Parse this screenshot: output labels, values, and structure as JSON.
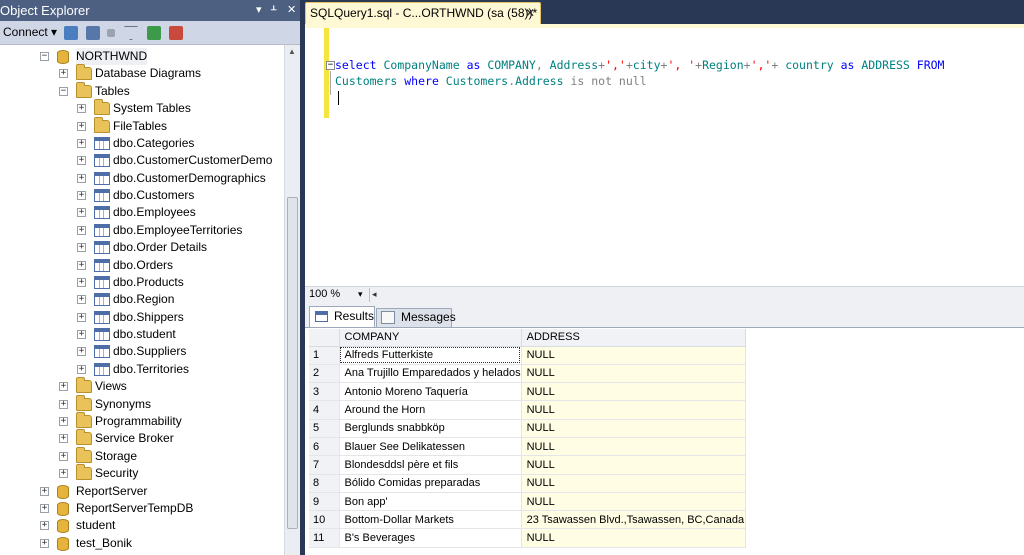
{
  "object_explorer": {
    "title": "Object Explorer",
    "pin_label": "▾ ⊥ ✕",
    "connect_label": "Connect ▾",
    "tree": [
      {
        "label": "NORTHWND",
        "icon": "database-icon",
        "expander": "−",
        "depth": 2,
        "selected": true
      },
      {
        "label": "Database Diagrams",
        "icon": "folder-icon",
        "expander": "+",
        "depth": 3
      },
      {
        "label": "Tables",
        "icon": "folder-icon",
        "expander": "−",
        "depth": 3
      },
      {
        "label": "System Tables",
        "icon": "folder-icon",
        "expander": "+",
        "depth": 4
      },
      {
        "label": "FileTables",
        "icon": "folder-icon",
        "expander": "+",
        "depth": 4
      },
      {
        "label": "dbo.Categories",
        "icon": "table-icon",
        "expander": "+",
        "depth": 4
      },
      {
        "label": "dbo.CustomerCustomerDemo",
        "icon": "table-icon",
        "expander": "+",
        "depth": 4
      },
      {
        "label": "dbo.CustomerDemographics",
        "icon": "table-icon",
        "expander": "+",
        "depth": 4
      },
      {
        "label": "dbo.Customers",
        "icon": "table-icon",
        "expander": "+",
        "depth": 4
      },
      {
        "label": "dbo.Employees",
        "icon": "table-icon",
        "expander": "+",
        "depth": 4
      },
      {
        "label": "dbo.EmployeeTerritories",
        "icon": "table-icon",
        "expander": "+",
        "depth": 4
      },
      {
        "label": "dbo.Order Details",
        "icon": "table-icon",
        "expander": "+",
        "depth": 4
      },
      {
        "label": "dbo.Orders",
        "icon": "table-icon",
        "expander": "+",
        "depth": 4
      },
      {
        "label": "dbo.Products",
        "icon": "table-icon",
        "expander": "+",
        "depth": 4
      },
      {
        "label": "dbo.Region",
        "icon": "table-icon",
        "expander": "+",
        "depth": 4
      },
      {
        "label": "dbo.Shippers",
        "icon": "table-icon",
        "expander": "+",
        "depth": 4
      },
      {
        "label": "dbo.student",
        "icon": "table-icon",
        "expander": "+",
        "depth": 4
      },
      {
        "label": "dbo.Suppliers",
        "icon": "table-icon",
        "expander": "+",
        "depth": 4
      },
      {
        "label": "dbo.Territories",
        "icon": "table-icon",
        "expander": "+",
        "depth": 4
      },
      {
        "label": "Views",
        "icon": "folder-icon",
        "expander": "+",
        "depth": 3
      },
      {
        "label": "Synonyms",
        "icon": "folder-icon",
        "expander": "+",
        "depth": 3
      },
      {
        "label": "Programmability",
        "icon": "folder-icon",
        "expander": "+",
        "depth": 3
      },
      {
        "label": "Service Broker",
        "icon": "folder-icon",
        "expander": "+",
        "depth": 3
      },
      {
        "label": "Storage",
        "icon": "folder-icon",
        "expander": "+",
        "depth": 3
      },
      {
        "label": "Security",
        "icon": "folder-icon",
        "expander": "+",
        "depth": 3
      },
      {
        "label": "ReportServer",
        "icon": "database-icon",
        "expander": "+",
        "depth": 2
      },
      {
        "label": "ReportServerTempDB",
        "icon": "database-icon",
        "expander": "+",
        "depth": 2
      },
      {
        "label": "student",
        "icon": "database-icon",
        "expander": "+",
        "depth": 2
      },
      {
        "label": "test_Bonik",
        "icon": "database-icon",
        "expander": "+",
        "depth": 2
      }
    ]
  },
  "document_tab": {
    "title": "SQLQuery1.sql - C...ORTHWND (sa (58))*",
    "close": "✕"
  },
  "editor": {
    "collapse_glyph": "−",
    "line1": {
      "k1": "select",
      "t1": " CompanyName ",
      "k2": "as",
      "t2": " COMPANY",
      "g1": ",",
      "t3": " Address",
      "g2": "+",
      "s1": "','",
      "g3": "+",
      "t4": "city",
      "g4": "+",
      "s2": "', '",
      "g5": "+",
      "t5": "Region",
      "g6": "+",
      "s3": "','",
      "g7": "+",
      "t6": " country ",
      "k3": "as",
      "t7": " ADDRESS ",
      "k4": "FROM"
    },
    "line2": {
      "t1": "Customers ",
      "k1": "where",
      "t2": " Customers",
      "g1": ".",
      "t3": "Address ",
      "g2": "is not null"
    }
  },
  "zoom": {
    "value": "100 %",
    "dropdown": "▾",
    "left_arrow": "◂"
  },
  "results_tabs": {
    "results_label": "Results",
    "messages_label": "Messages"
  },
  "grid": {
    "columns": [
      "COMPANY",
      "ADDRESS"
    ],
    "rows": [
      {
        "n": "1",
        "company": "Alfreds Futterkiste",
        "address": "NULL"
      },
      {
        "n": "2",
        "company": "Ana Trujillo Emparedados y helados",
        "address": "NULL"
      },
      {
        "n": "3",
        "company": "Antonio Moreno Taquería",
        "address": "NULL"
      },
      {
        "n": "4",
        "company": "Around the Horn",
        "address": "NULL"
      },
      {
        "n": "5",
        "company": "Berglunds snabbköp",
        "address": "NULL"
      },
      {
        "n": "6",
        "company": "Blauer See Delikatessen",
        "address": "NULL"
      },
      {
        "n": "7",
        "company": "Blondesddsl père et fils",
        "address": "NULL"
      },
      {
        "n": "8",
        "company": "Bólido Comidas preparadas",
        "address": "NULL"
      },
      {
        "n": "9",
        "company": "Bon app'",
        "address": "NULL"
      },
      {
        "n": "10",
        "company": "Bottom-Dollar Markets",
        "address": "23 Tsawassen Blvd.,Tsawassen, BC,Canada"
      },
      {
        "n": "11",
        "company": "B's Beverages",
        "address": "NULL"
      }
    ]
  },
  "colors": {
    "dark_chrome": "#293955",
    "title_bar": "#4d6082",
    "tab_active": "#fff8d5",
    "keyword": "#0000ff",
    "string": "#ff0000",
    "operator": "#808080",
    "address_column_bg": "#fffde4"
  }
}
